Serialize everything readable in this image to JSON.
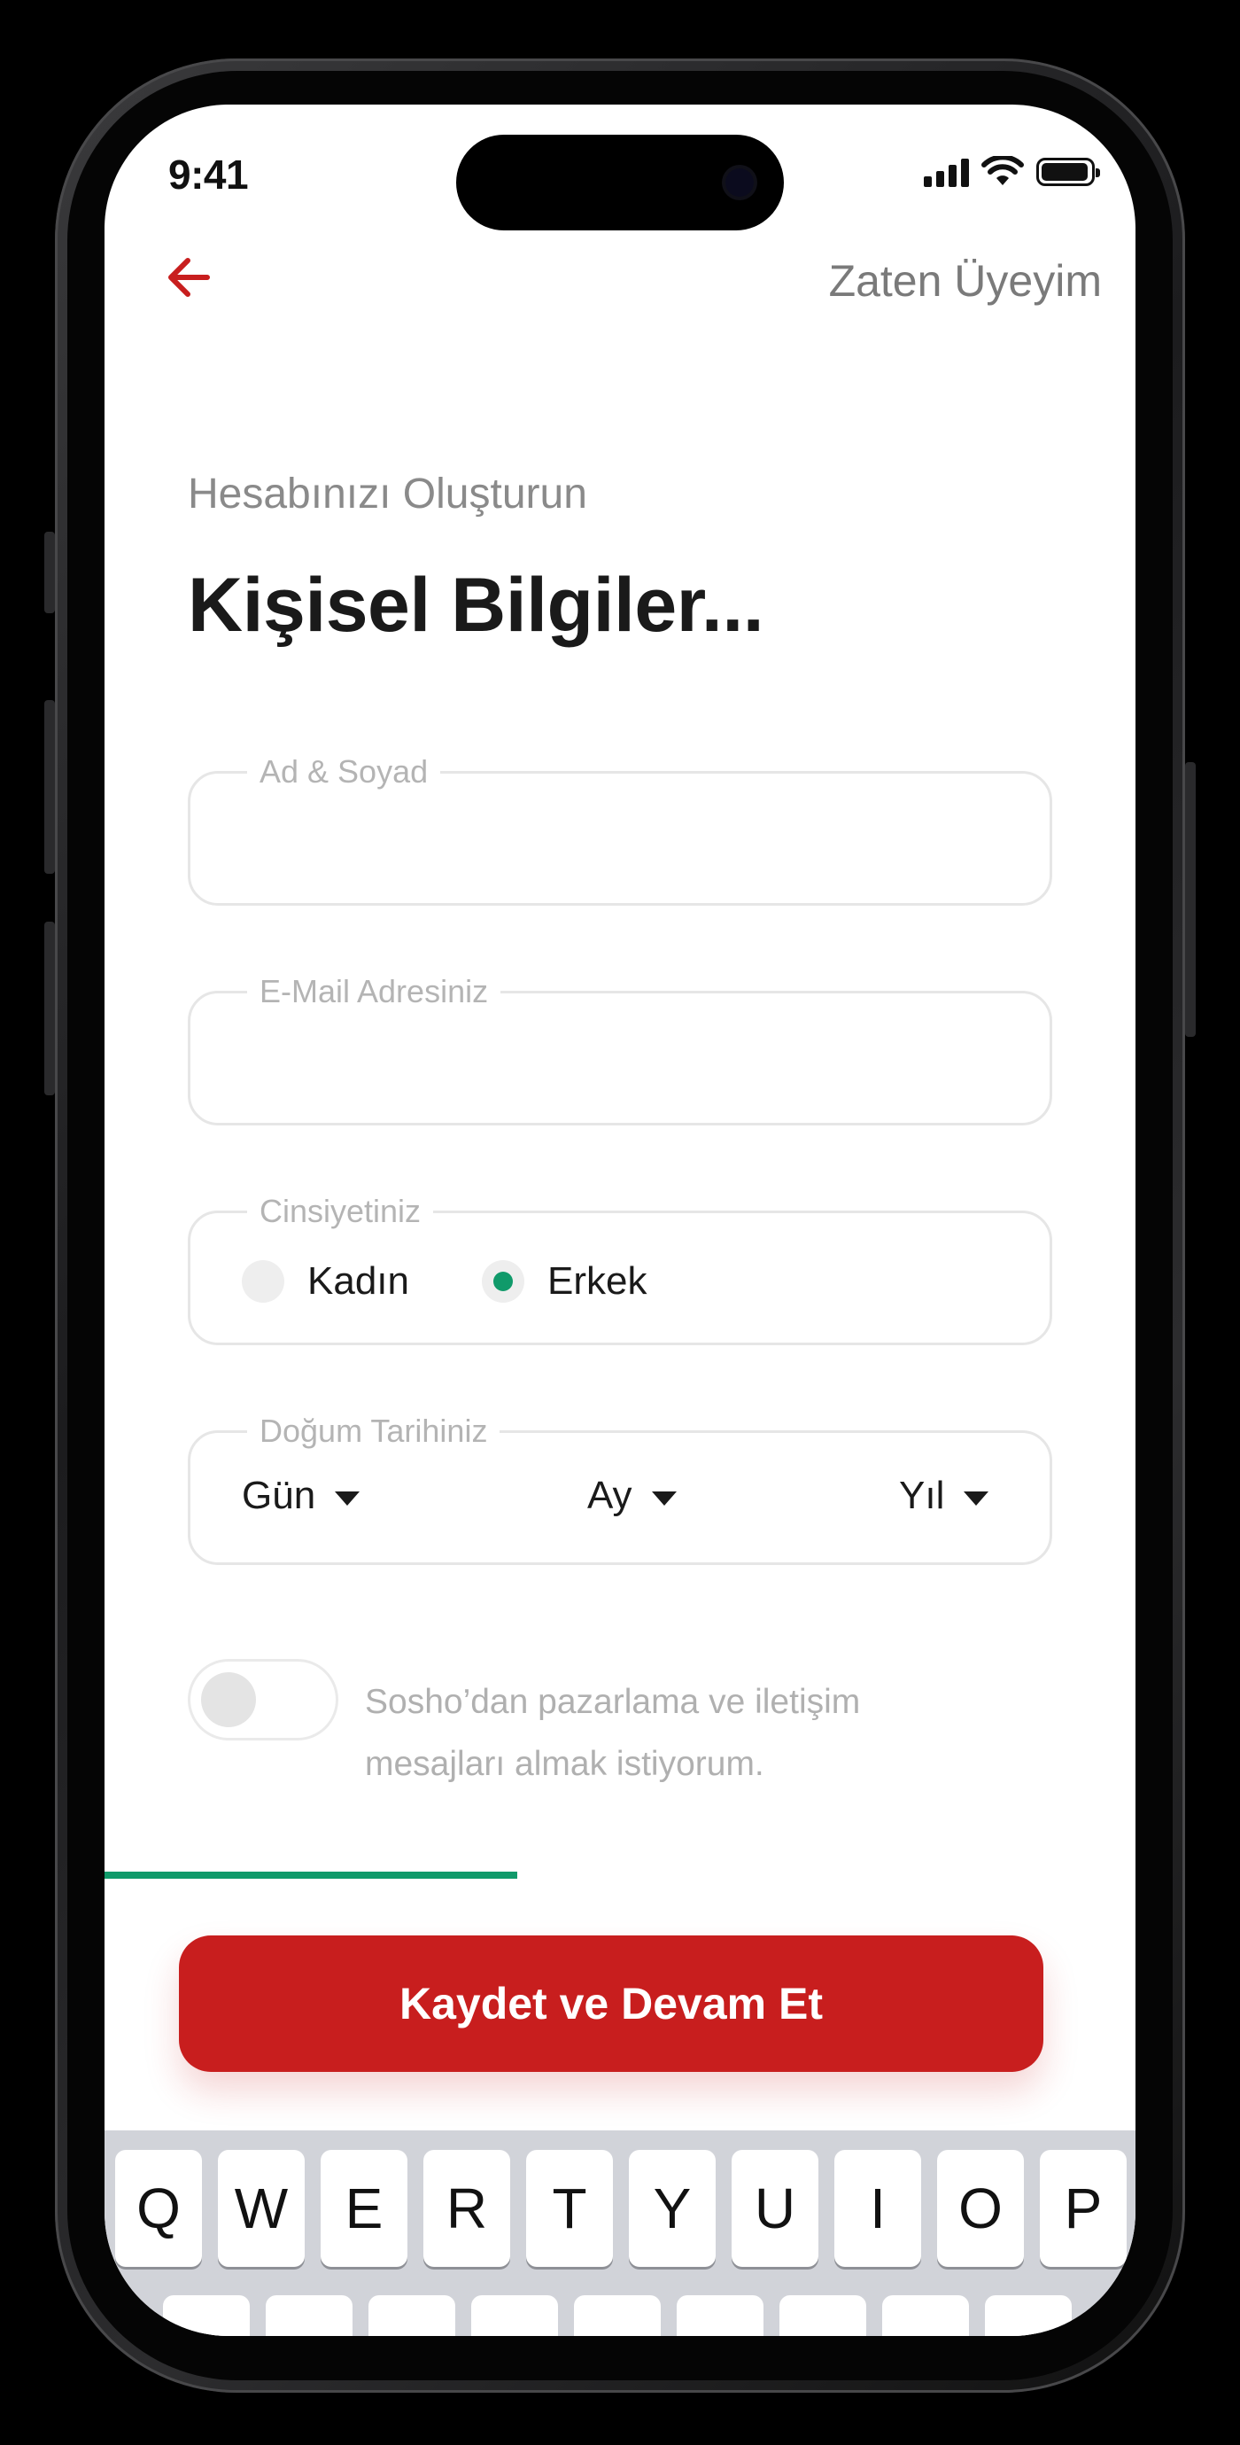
{
  "status_bar": {
    "time": "9:41",
    "signal_icon": "cellular-signal-icon",
    "wifi_icon": "wifi-icon",
    "battery_icon": "battery-icon"
  },
  "nav": {
    "back_icon": "arrow-left-icon",
    "back_color": "#c81e1e",
    "already_member": "Zaten Üyeyim"
  },
  "header": {
    "subtitle": "Hesabınızı Oluşturun",
    "title": "Kişisel Bilgiler..."
  },
  "form": {
    "name": {
      "label": "Ad & Soyad",
      "value": ""
    },
    "email": {
      "label": "E-Mail Adresiniz",
      "value": ""
    },
    "gender": {
      "label": "Cinsiyetiniz",
      "options": [
        {
          "label": "Kadın",
          "selected": false
        },
        {
          "label": "Erkek",
          "selected": true
        }
      ]
    },
    "birthdate": {
      "label": "Doğum Tarihiniz",
      "day": "Gün",
      "month": "Ay",
      "year": "Yıl"
    },
    "marketing_consent": {
      "text": "Sosho’dan pazarlama ve iletişim mesajları almak istiyorum.",
      "enabled": false
    }
  },
  "progress": {
    "fraction": 0.4,
    "color": "#109a6a"
  },
  "cta": {
    "label": "Kaydet ve Devam Et",
    "color": "#c81e1e"
  },
  "keyboard": {
    "row1": [
      "Q",
      "W",
      "E",
      "R",
      "T",
      "Y",
      "U",
      "I",
      "O",
      "P"
    ]
  }
}
